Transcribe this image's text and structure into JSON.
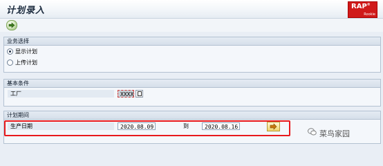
{
  "window": {
    "title": "计划录入",
    "logo": {
      "main": "RAP",
      "sup": "®",
      "sub": "Rookie"
    }
  },
  "toolbar": {
    "execute_icon": "execute-icon"
  },
  "business_selection": {
    "header": "业务选择",
    "options": [
      {
        "label": "显示计划",
        "selected": true
      },
      {
        "label": "上传计划",
        "selected": false
      }
    ]
  },
  "basic_conditions": {
    "header": "基本条件",
    "plant_label": "工厂",
    "plant_value": "XXXX"
  },
  "plan_period": {
    "header": "计划期间",
    "production_date_label": "生产日期",
    "date_from": "2020.08.09",
    "to_label": "到",
    "date_to": "2020.08.16"
  },
  "watermark": {
    "text": "菜鸟家园"
  },
  "colors": {
    "highlight_border": "#e8191c",
    "logo_bg": "#d01a1a"
  }
}
